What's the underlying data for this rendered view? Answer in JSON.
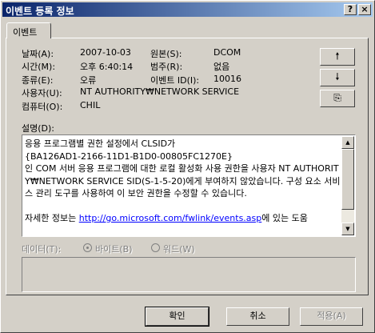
{
  "window": {
    "title": "이벤트 등록 정보",
    "help_glyph": "?",
    "close_glyph": "×"
  },
  "tabs": [
    {
      "label": "이벤트"
    }
  ],
  "fields": {
    "date_label": "날짜(A):",
    "date_value": "2007-10-03",
    "time_label": "시간(M):",
    "time_value": "오후 6:40:14",
    "type_label": "종류(E):",
    "type_value": "오류",
    "user_label": "사용자(U):",
    "user_value": "NT AUTHORITY₩NETWORK SERVICE",
    "computer_label": "컴퓨터(O):",
    "computer_value": "CHIL",
    "source_label": "원본(S):",
    "source_value": "DCOM",
    "category_label": "범주(R):",
    "category_value": "없음",
    "event_id_label": "이벤트 ID(I):",
    "event_id_value": "10016"
  },
  "side_buttons": {
    "up_icon": "arrow-up-icon",
    "up_glyph": "🠕",
    "down_icon": "arrow-down-icon",
    "down_glyph": "🠗",
    "copy_icon": "copy-icon",
    "copy_glyph": "⎘"
  },
  "description": {
    "label": "설명(D):",
    "text": "응용 프로그램별 권한 설정에서 CLSID가\n{BA126AD1-2166-11D1-B1D0-00805FC1270E}\n인 COM 서버 응용 프로그램에 대한 로컬 활성화 사용 권한을 사용자 NT AUTHORITY₩NETWORK SERVICE SID(S-1-5-20)에게 부여하지 않았습니다. 구성 요소 서비스 관리 도구를 사용하여 이 보안 권한을 수정할 수 있습니다.\n\n",
    "more_prefix": "자세한 정보는 ",
    "more_link": "http://go.microsoft.com/fwlink/events.asp",
    "more_suffix": "에 있는 도움"
  },
  "data_section": {
    "label": "데이터(T):",
    "bytes_label": "바이트(B)",
    "words_label": "워드(W)",
    "selected": "bytes"
  },
  "buttons": {
    "ok": "확인",
    "cancel": "취소",
    "apply": "적용(A)"
  }
}
